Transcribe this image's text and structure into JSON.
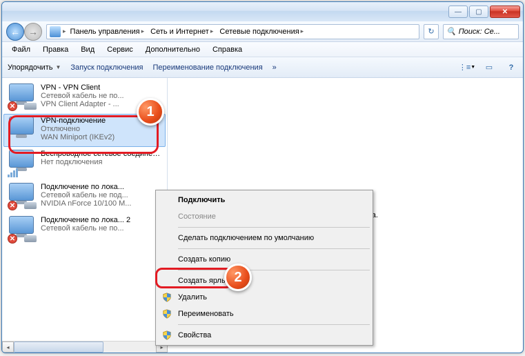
{
  "window": {
    "min": "—",
    "max": "▢",
    "close": "✕"
  },
  "breadcrumb": {
    "seg1": "Панель управления",
    "seg2": "Сеть и Интернет",
    "seg3": "Сетевые подключения"
  },
  "search": {
    "placeholder": "Поиск: Се..."
  },
  "menu": {
    "file": "Файл",
    "edit": "Правка",
    "view": "Вид",
    "tools": "Сервис",
    "extra": "Дополнительно",
    "help": "Справка"
  },
  "toolbar": {
    "organize": "Упорядочить",
    "start": "Запуск подключения",
    "rename": "Переименование подключения",
    "more": "»"
  },
  "connections": [
    {
      "name": "VPN - VPN Client",
      "status": "Сетевой кабель не по...",
      "device": "VPN Client Adapter - ...",
      "x": true,
      "plug": true
    },
    {
      "name": "VPN-подключение",
      "status": "Отключено",
      "device": "WAN Miniport (IKEv2)",
      "sel": true,
      "plug": false
    },
    {
      "name": "Беспроводное сетевое соединение",
      "status": "Нет подключения",
      "device": "",
      "bars": true
    },
    {
      "name": "Подключение по лока...",
      "status": "Сетевой кабель не под...",
      "device": "NVIDIA nForce 10/100 M...",
      "x": true,
      "plug": true
    },
    {
      "name": "Подключение по лока... 2",
      "status": "Сетевой кабель не по...",
      "device": "",
      "x": true,
      "plug": true
    }
  ],
  "preview": "льного просмотра.",
  "ctx": {
    "connect": "Подключить",
    "state": "Состояние",
    "setdefault": "Сделать подключением по умолчанию",
    "copy": "Создать копию",
    "shortcut": "Создать ярлык",
    "delete": "Удалить",
    "rename": "Переименовать",
    "props": "Свойства"
  },
  "badges": {
    "b1": "1",
    "b2": "2"
  }
}
